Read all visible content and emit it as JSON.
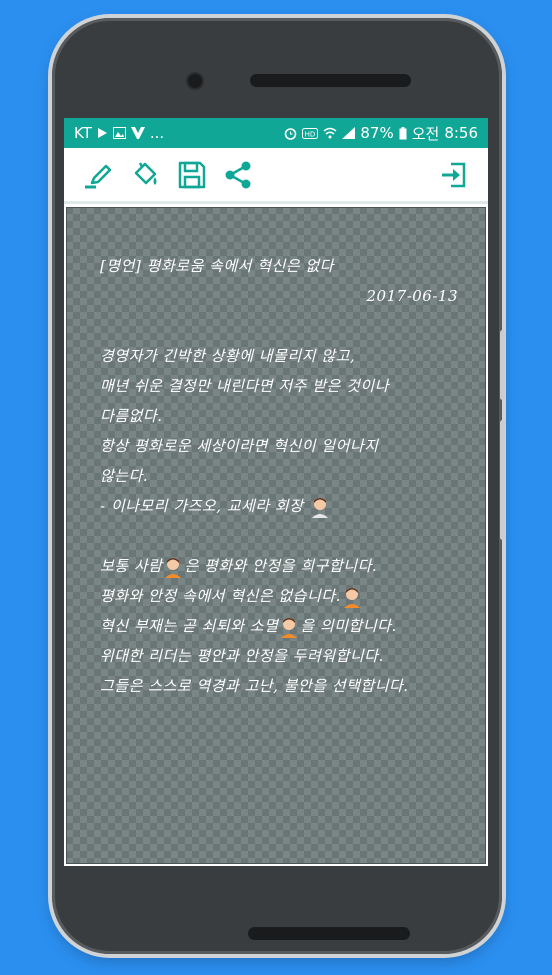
{
  "status_bar": {
    "carrier": "KT",
    "left_icons": [
      "play-store-icon",
      "image-icon",
      "notification-icon"
    ],
    "overflow": "...",
    "right_icons": [
      "alarm-icon",
      "hd-icon",
      "wifi-icon",
      "signal-icon"
    ],
    "battery": "87%",
    "ampm": "오전",
    "time": "8:56"
  },
  "toolbar": {
    "items": [
      "pen-icon",
      "paint-bucket-icon",
      "save-icon",
      "share-icon"
    ],
    "exit": "exit-icon",
    "accent": "#10a796"
  },
  "note": {
    "title": "[명언] 평화로움 속에서 혁신은 없다",
    "date": "2017-06-13",
    "lines": [
      "경영자가 긴박한 상황에 내몰리지 않고,",
      "매년 쉬운 결정만 내린다면 저주 받은 것이나",
      "다름없다.",
      "항상 평화로운 세상이라면 혁신이 일어나지",
      "않는다.",
      "- 이나모리 가즈오, 교세라 회장"
    ],
    "para2": [
      "보통 사람",
      "은 평화와 안정을 희구합니다.",
      "평화와 안정 속에서 혁신은 없습니다.",
      "혁신 부재는 곧 쇠퇴와 소멸",
      "을 의미합니다.",
      "위대한 리더는 평안과 안정을 두려워합니다.",
      "그들은 스스로 역경과 고난, 불안을 선택합니다."
    ]
  },
  "colors": {
    "background": "#2b8ff0",
    "statusbar": "#10a796",
    "canvas": "#6a7676"
  }
}
